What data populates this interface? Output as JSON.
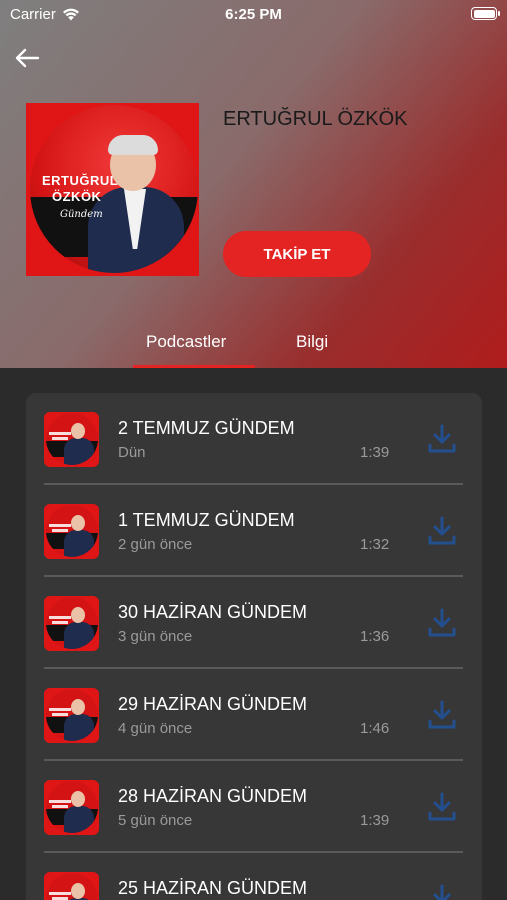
{
  "status_bar": {
    "carrier": "Carrier",
    "time": "6:25 PM"
  },
  "podcast": {
    "title": "ERTUĞRUL ÖZKÖK",
    "follow_label": "TAKİP ET",
    "cover_name_line1": "ERTUĞRUL",
    "cover_name_line2": "ÖZKÖK",
    "cover_subtitle": "Gündem"
  },
  "tabs": [
    {
      "label": "Podcastler",
      "active": true
    },
    {
      "label": "Bilgi",
      "active": false
    }
  ],
  "colors": {
    "accent": "#e42323",
    "background": "#2b2b2b",
    "card": "#373737",
    "download_icon": "#234f8f"
  },
  "icons": {
    "back": "arrow-left-icon",
    "download": "download-icon",
    "wifi": "wifi-icon",
    "battery": "battery-icon"
  },
  "episodes": [
    {
      "title": "2 TEMMUZ GÜNDEM",
      "date": "Dün",
      "duration": "1:39"
    },
    {
      "title": "1 TEMMUZ GÜNDEM",
      "date": "2 gün önce",
      "duration": "1:32"
    },
    {
      "title": "30 HAZİRAN GÜNDEM",
      "date": "3 gün önce",
      "duration": "1:36"
    },
    {
      "title": "29 HAZİRAN GÜNDEM",
      "date": "4 gün önce",
      "duration": "1:46"
    },
    {
      "title": "28 HAZİRAN GÜNDEM",
      "date": "5 gün önce",
      "duration": "1:39"
    },
    {
      "title": "25 HAZİRAN GÜNDEM",
      "date": "",
      "duration": ""
    }
  ]
}
